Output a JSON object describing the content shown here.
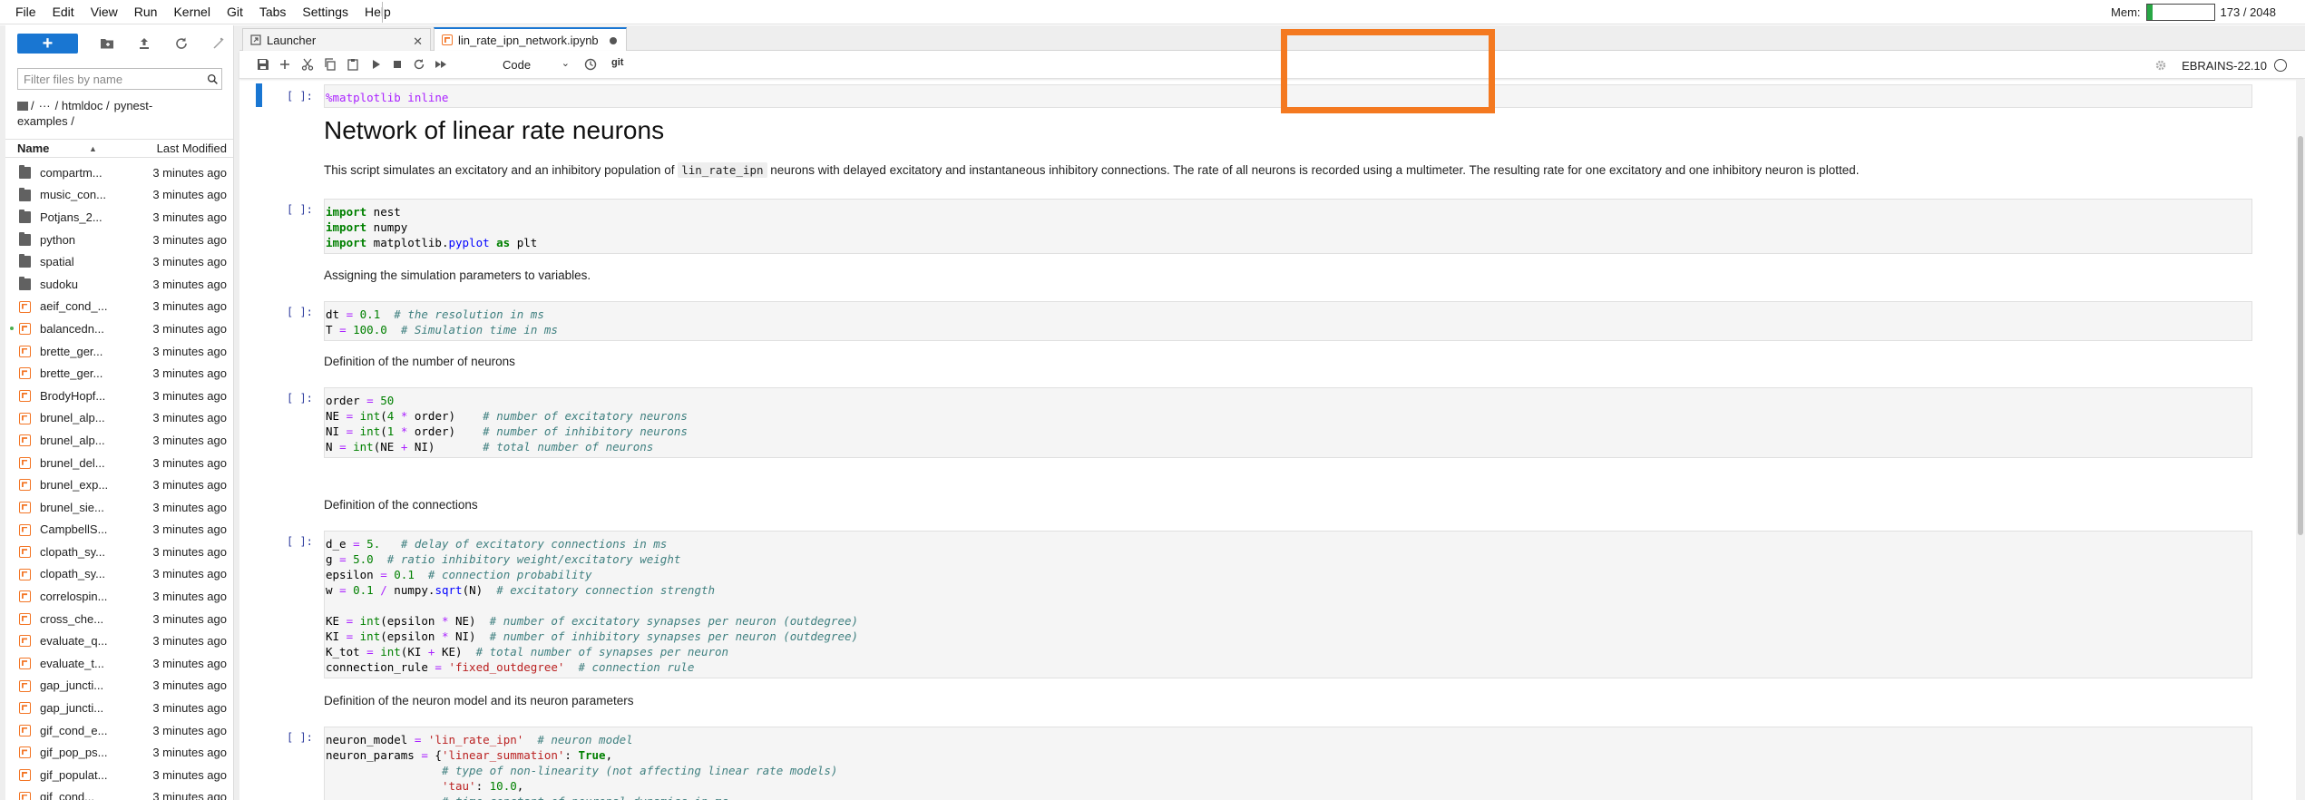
{
  "menu": {
    "items": [
      "File",
      "Edit",
      "View",
      "Run",
      "Kernel",
      "Git",
      "Tabs",
      "Settings",
      "Help"
    ]
  },
  "memory": {
    "label": "Mem:",
    "value": "173 / 2048",
    "fraction": 0.084
  },
  "filebrowser": {
    "new_label": "+",
    "filter_placeholder": "Filter files by name",
    "breadcrumb": [
      "/",
      "···",
      "/ htmldoc /",
      "pynest-",
      "examples /"
    ],
    "col_name": "Name",
    "col_modified": "Last Modified",
    "files": [
      {
        "name": "compartm...",
        "type": "folder",
        "modified": "3 minutes ago"
      },
      {
        "name": "music_con...",
        "type": "folder",
        "modified": "3 minutes ago"
      },
      {
        "name": "Potjans_2...",
        "type": "folder",
        "modified": "3 minutes ago"
      },
      {
        "name": "python",
        "type": "folder",
        "modified": "3 minutes ago"
      },
      {
        "name": "spatial",
        "type": "folder",
        "modified": "3 minutes ago"
      },
      {
        "name": "sudoku",
        "type": "folder",
        "modified": "3 minutes ago"
      },
      {
        "name": "aeif_cond_...",
        "type": "notebook",
        "modified": "3 minutes ago"
      },
      {
        "name": "balancedn...",
        "type": "notebook",
        "modified": "3 minutes ago",
        "running": true
      },
      {
        "name": "brette_ger...",
        "type": "notebook",
        "modified": "3 minutes ago"
      },
      {
        "name": "brette_ger...",
        "type": "notebook",
        "modified": "3 minutes ago"
      },
      {
        "name": "BrodyHopf...",
        "type": "notebook",
        "modified": "3 minutes ago"
      },
      {
        "name": "brunel_alp...",
        "type": "notebook",
        "modified": "3 minutes ago"
      },
      {
        "name": "brunel_alp...",
        "type": "notebook",
        "modified": "3 minutes ago"
      },
      {
        "name": "brunel_del...",
        "type": "notebook",
        "modified": "3 minutes ago"
      },
      {
        "name": "brunel_exp...",
        "type": "notebook",
        "modified": "3 minutes ago"
      },
      {
        "name": "brunel_sie...",
        "type": "notebook",
        "modified": "3 minutes ago"
      },
      {
        "name": "CampbellS...",
        "type": "notebook",
        "modified": "3 minutes ago"
      },
      {
        "name": "clopath_sy...",
        "type": "notebook",
        "modified": "3 minutes ago"
      },
      {
        "name": "clopath_sy...",
        "type": "notebook",
        "modified": "3 minutes ago"
      },
      {
        "name": "correlospin...",
        "type": "notebook",
        "modified": "3 minutes ago"
      },
      {
        "name": "cross_che...",
        "type": "notebook",
        "modified": "3 minutes ago"
      },
      {
        "name": "evaluate_q...",
        "type": "notebook",
        "modified": "3 minutes ago"
      },
      {
        "name": "evaluate_t...",
        "type": "notebook",
        "modified": "3 minutes ago"
      },
      {
        "name": "gap_juncti...",
        "type": "notebook",
        "modified": "3 minutes ago"
      },
      {
        "name": "gap_juncti...",
        "type": "notebook",
        "modified": "3 minutes ago"
      },
      {
        "name": "gif_cond_e...",
        "type": "notebook",
        "modified": "3 minutes ago"
      },
      {
        "name": "gif_pop_ps...",
        "type": "notebook",
        "modified": "3 minutes ago"
      },
      {
        "name": "gif_populat...",
        "type": "notebook",
        "modified": "3 minutes ago"
      },
      {
        "name": "gif_cond...",
        "type": "notebook",
        "modified": "3 minutes ago"
      }
    ]
  },
  "tabs": {
    "launcher": "Launcher",
    "notebook": "lin_rate_ipn_network.ipynb"
  },
  "toolbar": {
    "cell_type": "Code",
    "git": "git",
    "kernel_name": "EBRAINS-22.10"
  },
  "notebook": {
    "prompt": "[ ]:",
    "cell1": "%matplotlib inline",
    "title": "Network of linear rate neurons",
    "intro_before": "This script simulates an excitatory and an inhibitory population of ",
    "intro_code": "lin_rate_ipn",
    "intro_after": " neurons with delayed excitatory and instantaneous inhibitory connections. The rate of all neurons is recorded using a multimeter. The resulting rate for one excitatory and one inhibitory neuron is plotted.",
    "md_params": "Assigning the simulation parameters to variables.",
    "md_number": "Definition of the number of neurons",
    "md_connections": "Definition of the connections",
    "md_model": "Definition of the neuron model and its neuron parameters"
  }
}
